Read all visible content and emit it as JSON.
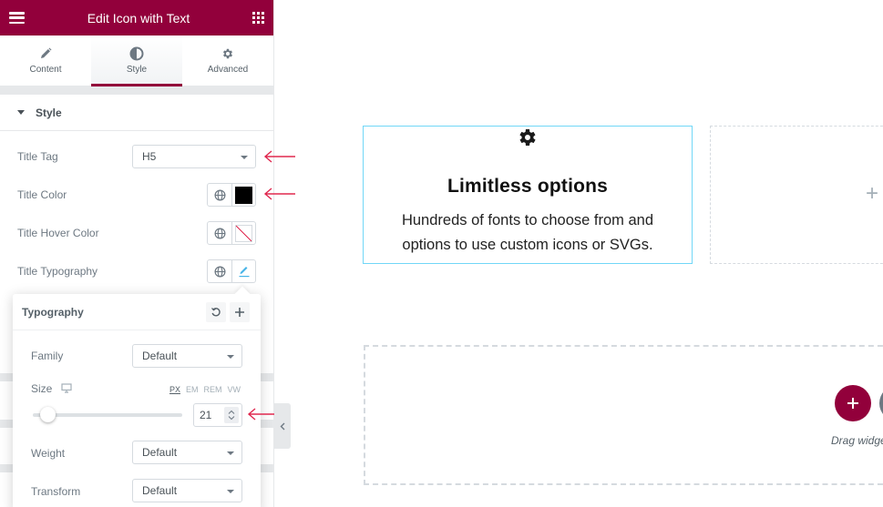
{
  "panel": {
    "header": {
      "title": "Edit Icon with Text",
      "menu_icon": "hamburger-icon",
      "widgets_icon": "grid-icon",
      "background_color": "#92003b"
    },
    "tabs": [
      {
        "label": "Content",
        "icon": "pencil-icon",
        "active": false
      },
      {
        "label": "Style",
        "icon": "half-circle-icon",
        "active": true
      },
      {
        "label": "Advanced",
        "icon": "gear-icon",
        "active": false
      }
    ],
    "section": {
      "title": "Style",
      "expanded": true
    },
    "controls": {
      "title_tag": {
        "label": "Title Tag",
        "value": "H5"
      },
      "title_color": {
        "label": "Title Color",
        "value": "#000000"
      },
      "title_hover_color": {
        "label": "Title Hover Color",
        "value": ""
      },
      "title_typography": {
        "label": "Title Typography"
      }
    }
  },
  "typography_popover": {
    "title": "Typography",
    "reset_icon": "reset-icon",
    "add_icon": "plus-icon",
    "family": {
      "label": "Family",
      "value": "Default"
    },
    "size": {
      "label": "Size",
      "device_icon": "desktop-icon",
      "units": [
        "PX",
        "EM",
        "REM",
        "VW"
      ],
      "active_unit": "PX",
      "value": "21",
      "slider_fraction": 0.1
    },
    "weight": {
      "label": "Weight",
      "value": "Default"
    },
    "transform": {
      "label": "Transform",
      "value": "Default"
    }
  },
  "annotations": {
    "arrow_color": "#e0284f"
  },
  "canvas": {
    "widget": {
      "icon": "gear-icon",
      "title": "Limitless options",
      "description": "Hundreds of fonts to choose from and options to use custom icons or SVGs."
    },
    "empty_column": {
      "add_icon": "plus-icon"
    },
    "drop_section": {
      "add_button_icon": "plus-icon",
      "drag_text": "Drag widge",
      "accent_color": "#92003b"
    }
  }
}
